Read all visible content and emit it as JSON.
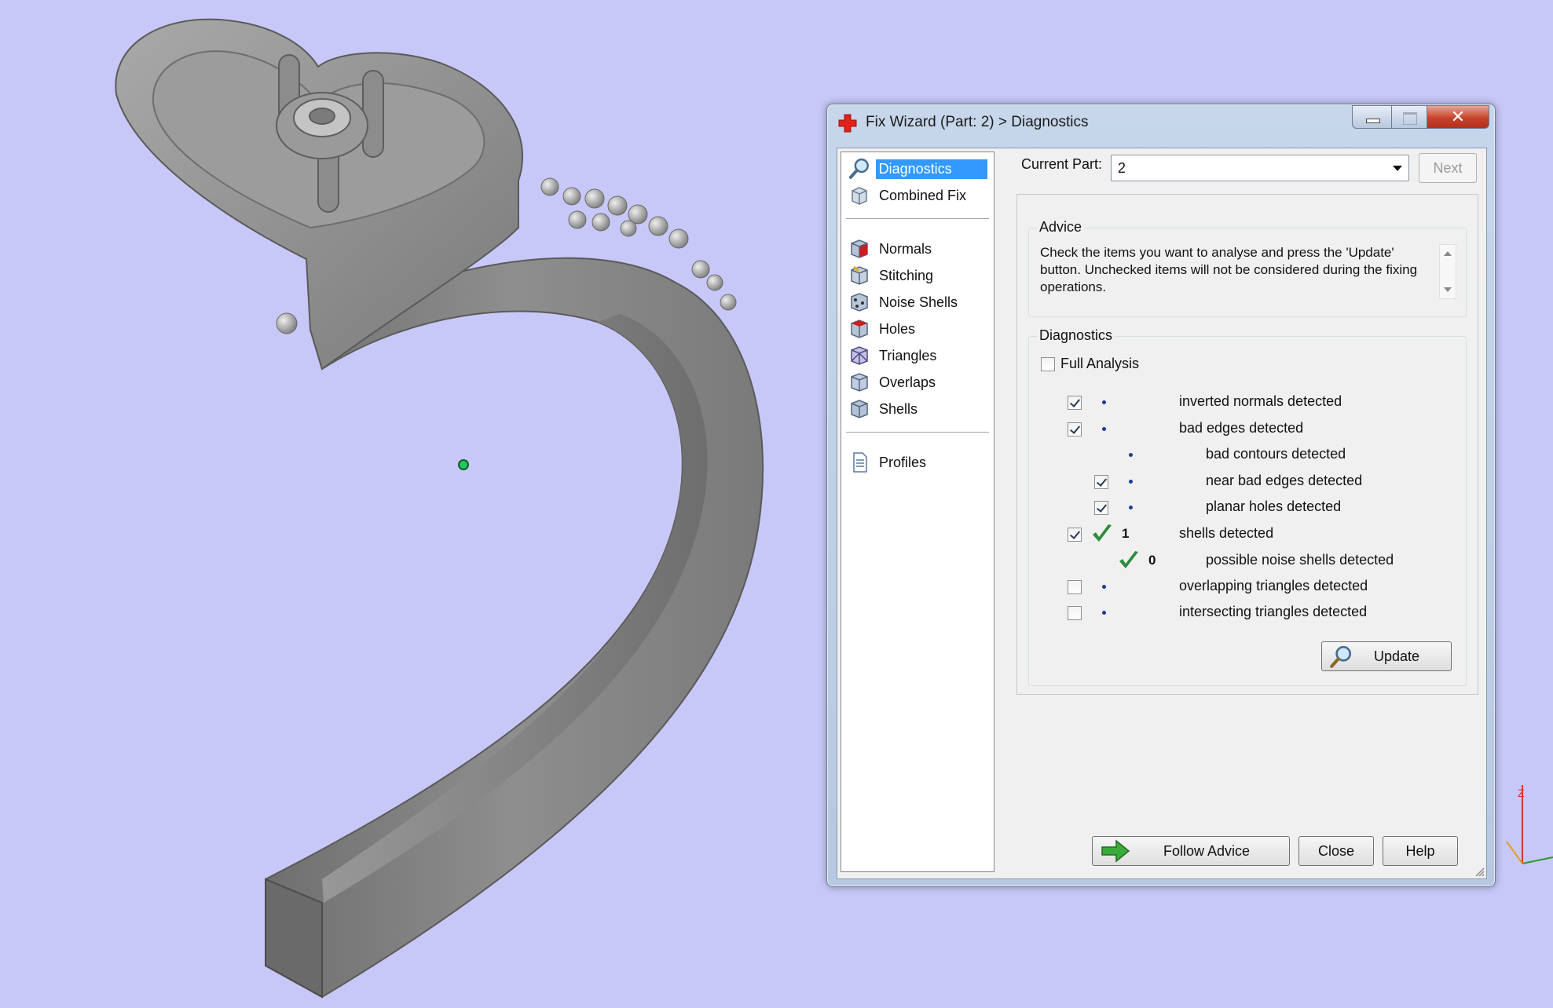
{
  "window": {
    "title": "Fix Wizard (Part: 2) > Diagnostics",
    "controls": [
      "minimize",
      "maximize",
      "close"
    ]
  },
  "nav": {
    "items": [
      {
        "label": "Diagnostics",
        "icon": "magnifier-icon",
        "selected": true
      },
      {
        "label": "Combined Fix",
        "icon": "combined-fix-icon"
      },
      {
        "label": "Normals",
        "icon": "normals-cube-icon"
      },
      {
        "label": "Stitching",
        "icon": "stitching-cube-icon"
      },
      {
        "label": "Noise Shells",
        "icon": "noise-shells-cube-icon"
      },
      {
        "label": "Holes",
        "icon": "holes-cube-icon"
      },
      {
        "label": "Triangles",
        "icon": "triangles-cube-icon"
      },
      {
        "label": "Overlaps",
        "icon": "overlaps-cube-icon"
      },
      {
        "label": "Shells",
        "icon": "shells-cube-icon"
      },
      {
        "label": "Profiles",
        "icon": "profiles-document-icon"
      }
    ]
  },
  "current_part": {
    "label": "Current Part:",
    "value": "2"
  },
  "next_button": "Next",
  "advice": {
    "title": "Advice",
    "text": "Check the items you want to analyse and press the 'Update' button. Unchecked items will not be considered during the fixing operations."
  },
  "diagnostics": {
    "title": "Diagnostics",
    "full_analysis": {
      "label": "Full Analysis",
      "checked": false
    },
    "rows": [
      {
        "label": "inverted normals detected",
        "checked": true,
        "status": "dot"
      },
      {
        "label": "bad edges detected",
        "checked": true,
        "status": "dot"
      },
      {
        "label": "bad contours detected",
        "status": "dot"
      },
      {
        "label": "near bad edges detected",
        "checked": true,
        "status": "dot"
      },
      {
        "label": "planar holes detected",
        "checked": true,
        "status": "dot"
      },
      {
        "label": "shells detected",
        "checked": true,
        "status": "ok",
        "count": "1"
      },
      {
        "label": "possible noise shells detected",
        "status": "ok",
        "count": "0"
      },
      {
        "label": "overlapping triangles detected",
        "checked": false,
        "status": "dot"
      },
      {
        "label": "intersecting triangles detected",
        "checked": false,
        "status": "dot"
      }
    ],
    "update_button": "Update"
  },
  "buttons": {
    "follow_advice": "Follow Advice",
    "close": "Close",
    "help": "Help"
  },
  "colors": {
    "background": "#c8c8f8",
    "model": "#8a8a8a",
    "selection": "#3399ff",
    "ok_check": "#2e8b3d"
  }
}
